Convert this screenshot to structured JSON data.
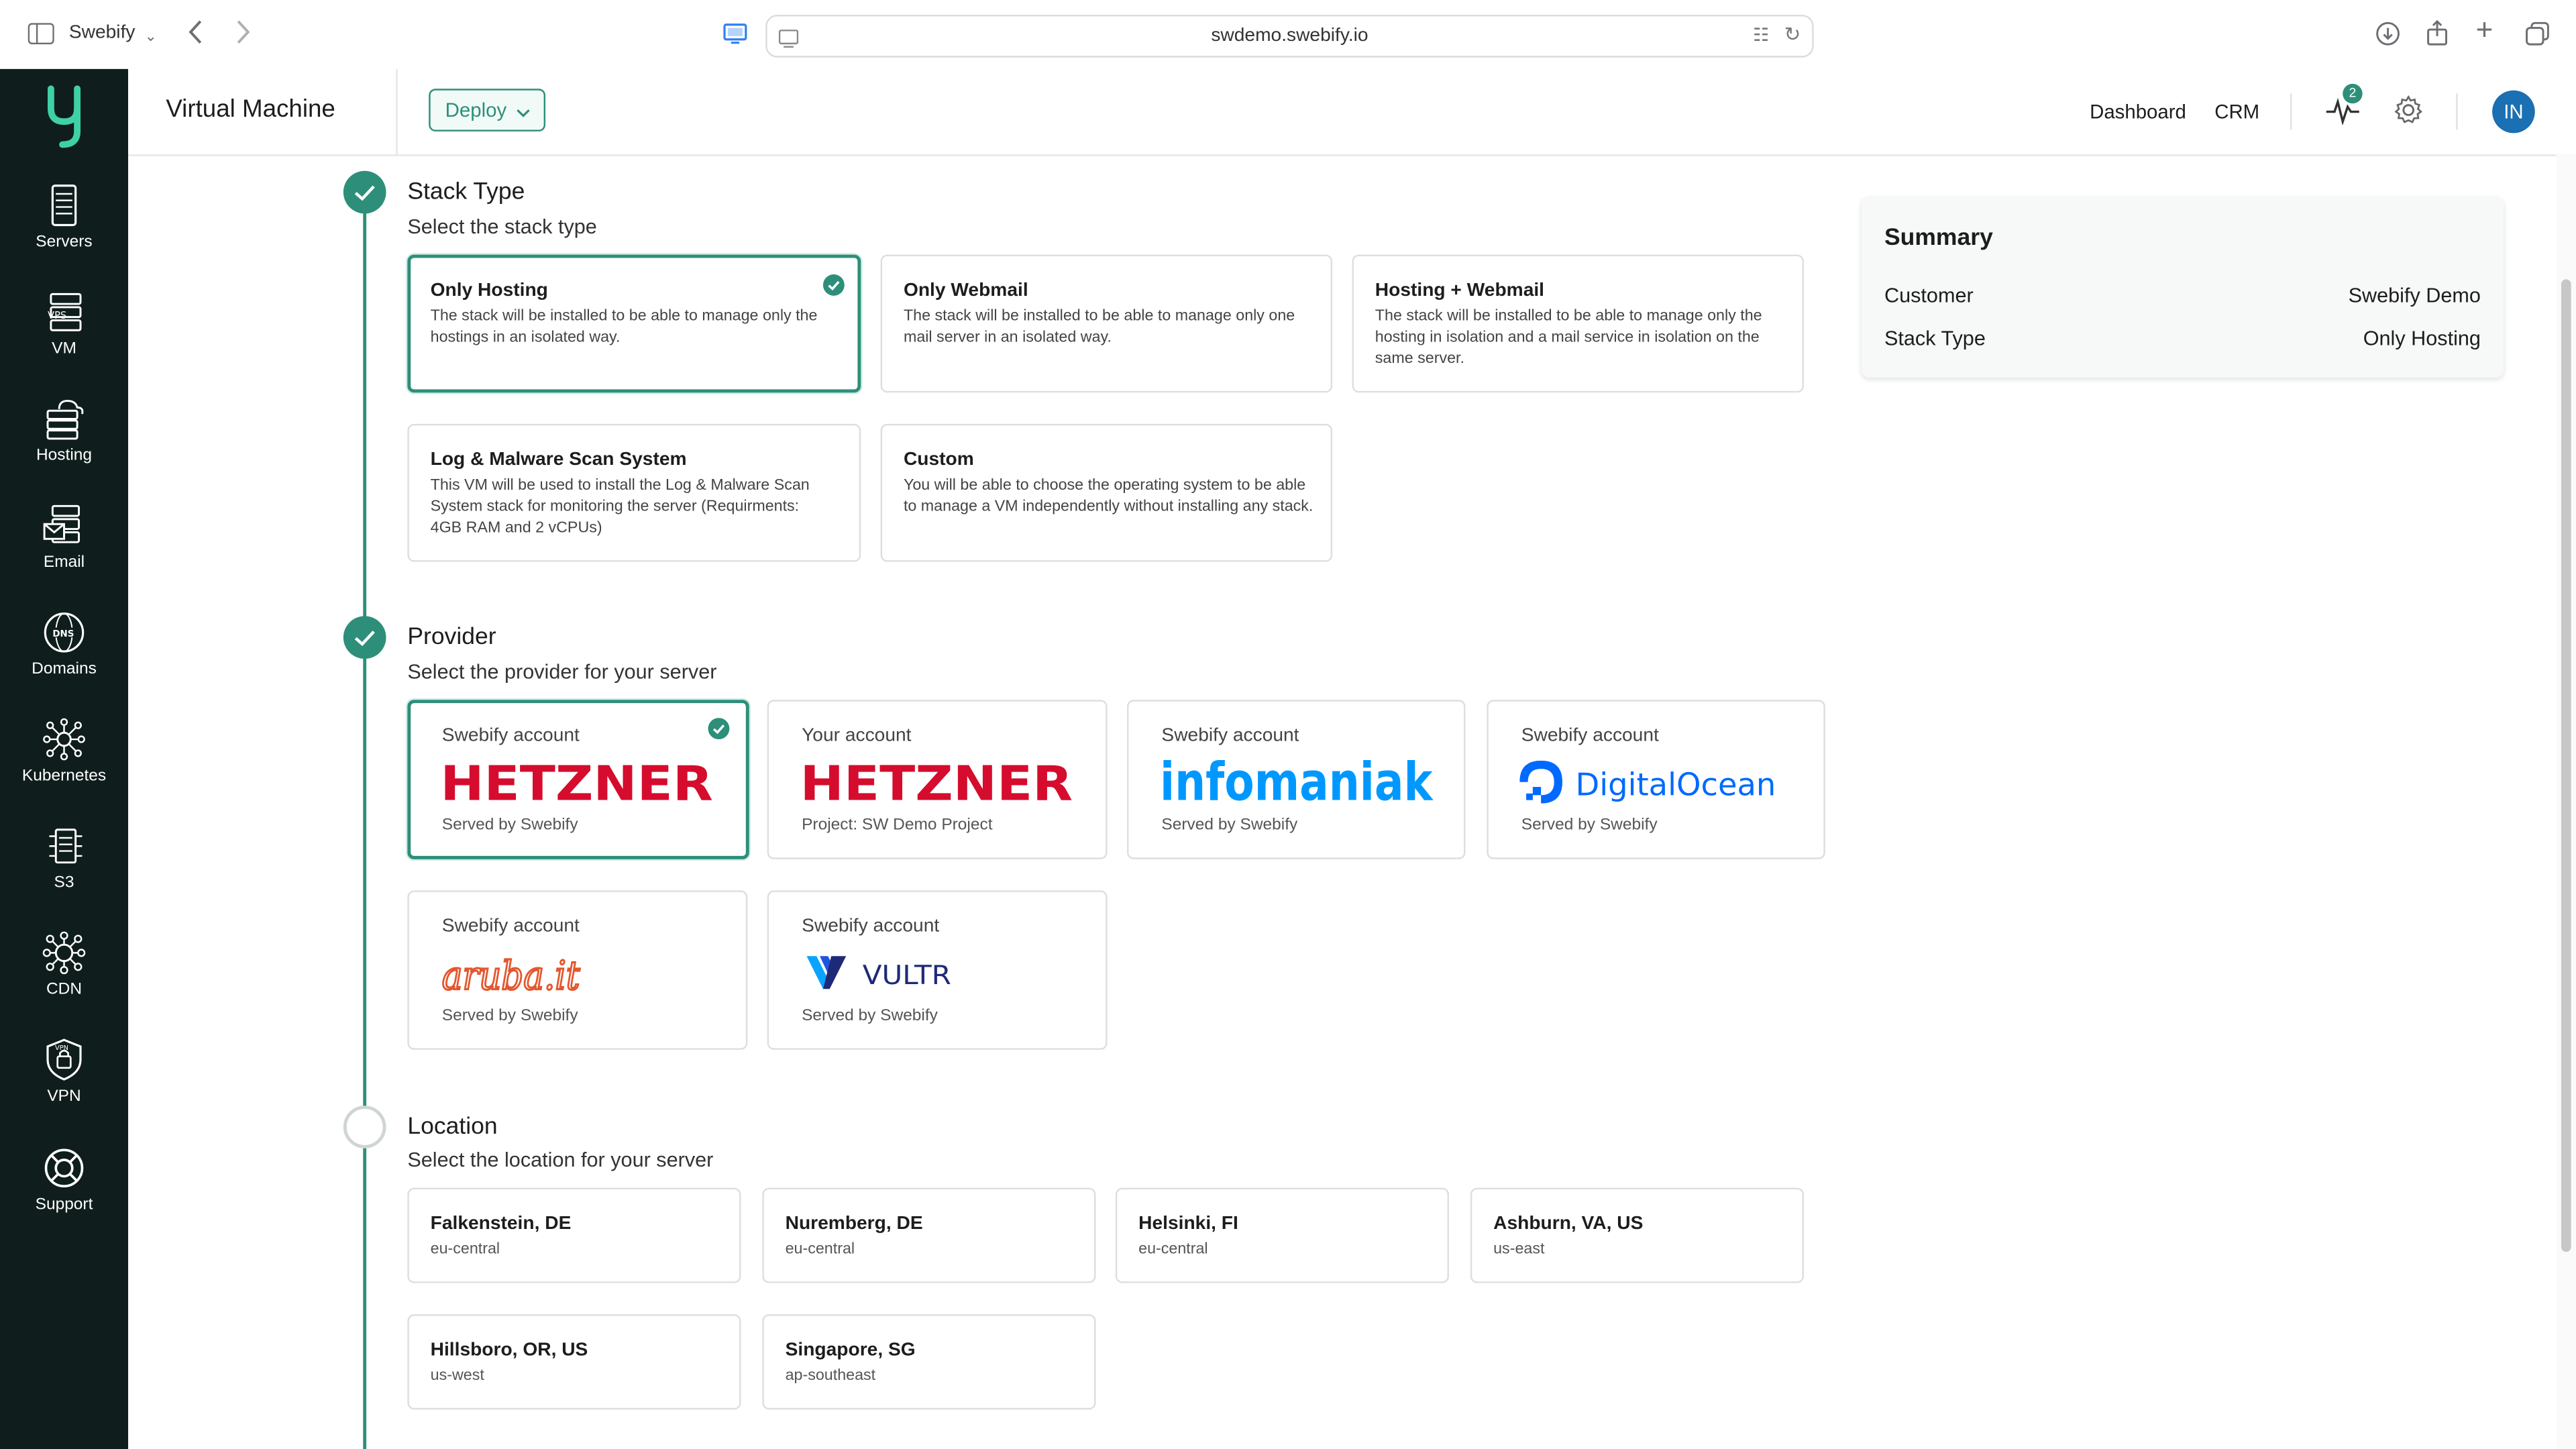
{
  "browser": {
    "tab_title": "Swebify",
    "url": "swdemo.swebify.io"
  },
  "sidebar": {
    "items": [
      {
        "label": "Servers",
        "icon": "server-icon"
      },
      {
        "label": "VM",
        "icon": "vm-icon"
      },
      {
        "label": "Hosting",
        "icon": "hosting-icon"
      },
      {
        "label": "Email",
        "icon": "email-icon"
      },
      {
        "label": "Domains",
        "icon": "dns-globe-icon"
      },
      {
        "label": "Kubernetes",
        "icon": "kubernetes-icon"
      },
      {
        "label": "S3",
        "icon": "s3-icon"
      },
      {
        "label": "CDN",
        "icon": "cdn-icon"
      },
      {
        "label": "VPN",
        "icon": "vpn-shield-icon"
      },
      {
        "label": "Support",
        "icon": "lifebuoy-icon"
      }
    ]
  },
  "header": {
    "title": "Virtual Machine",
    "deploy_label": "Deploy",
    "links": [
      "Dashboard",
      "CRM"
    ],
    "activity_badge": "2",
    "avatar_initials": "IN"
  },
  "stack": {
    "title": "Stack Type",
    "subtitle": "Select the stack type",
    "options": [
      {
        "title": "Only Hosting",
        "desc": "The stack will be installed to be able to manage only the hostings in an isolated way.",
        "selected": true
      },
      {
        "title": "Only Webmail",
        "desc": "The stack will be installed to be able to manage only one mail server in an isolated way.",
        "selected": false
      },
      {
        "title": "Hosting + Webmail",
        "desc": "The stack will be installed to be able to manage only the hosting in isolation and a mail service in isolation on the same server.",
        "selected": false
      },
      {
        "title": "Log & Malware Scan System",
        "desc": "This VM will be used to install the Log & Malware Scan System stack for monitoring the server (Requirments: 4GB RAM and 2 vCPUs)",
        "selected": false
      },
      {
        "title": "Custom",
        "desc": "You will be able to choose the operating system to be able to manage a VM independently without installing any stack.",
        "selected": false
      }
    ]
  },
  "provider": {
    "title": "Provider",
    "subtitle": "Select the provider for your server",
    "options": [
      {
        "account": "Swebify account",
        "logo": "HETZNER",
        "footer": "Served by Swebify",
        "selected": true
      },
      {
        "account": "Your account",
        "logo": "HETZNER",
        "footer": "Project: SW Demo Project",
        "selected": false
      },
      {
        "account": "Swebify account",
        "logo": "infomaniak",
        "footer": "Served by Swebify",
        "selected": false
      },
      {
        "account": "Swebify account",
        "logo": "DigitalOcean",
        "footer": "Served by Swebify",
        "selected": false
      },
      {
        "account": "Swebify account",
        "logo": "aruba.it",
        "footer": "Served by Swebify",
        "selected": false
      },
      {
        "account": "Swebify account",
        "logo": "VULTR",
        "footer": "Served by Swebify",
        "selected": false
      }
    ]
  },
  "location": {
    "title": "Location",
    "subtitle": "Select the location for your server",
    "options": [
      {
        "city": "Falkenstein, DE",
        "region": "eu-central"
      },
      {
        "city": "Nuremberg, DE",
        "region": "eu-central"
      },
      {
        "city": "Helsinki, FI",
        "region": "eu-central"
      },
      {
        "city": "Ashburn, VA, US",
        "region": "us-east"
      },
      {
        "city": "Hillsboro, OR, US",
        "region": "us-west"
      },
      {
        "city": "Singapore, SG",
        "region": "ap-southeast"
      }
    ]
  },
  "summary": {
    "title": "Summary",
    "rows": [
      {
        "key": "Customer",
        "value": "Swebify Demo"
      },
      {
        "key": "Stack Type",
        "value": "Only Hosting"
      }
    ]
  },
  "colors": {
    "accent": "#2d8f7a",
    "sidebar_bg": "#0f1e1c",
    "hetzner_red": "#d50c2d",
    "infomaniak_blue": "#0098ff",
    "digitalocean_blue": "#0069ff",
    "aruba_orange": "#e4572e",
    "vultr_blue": "#1e2a78"
  }
}
